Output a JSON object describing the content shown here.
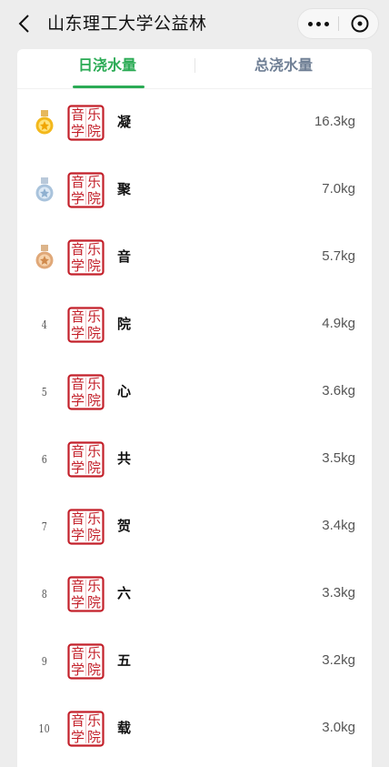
{
  "nav": {
    "title": "山东理工大学公益林"
  },
  "tabs": [
    {
      "label": "日浇水量",
      "active": true
    },
    {
      "label": "总浇水量",
      "active": false
    }
  ],
  "colors": {
    "accent": "#2bab55",
    "inactive_tab": "#6f7f95",
    "seal_red": "#c3202a",
    "gold": "#f0b400",
    "silver": "#a9c3dc",
    "bronze": "#d9a06a"
  },
  "avatar": {
    "chars": [
      "音",
      "乐",
      "学",
      "院"
    ]
  },
  "rankings": [
    {
      "rank": "1",
      "medal": "gold-medal-icon",
      "name": "凝",
      "amount": "16.3kg"
    },
    {
      "rank": "2",
      "medal": "silver-medal-icon",
      "name": "聚",
      "amount": "7.0kg"
    },
    {
      "rank": "3",
      "medal": "bronze-medal-icon",
      "name": "音",
      "amount": "5.7kg"
    },
    {
      "rank": "4",
      "medal": "",
      "name": "院",
      "amount": "4.9kg"
    },
    {
      "rank": "5",
      "medal": "",
      "name": "心",
      "amount": "3.6kg"
    },
    {
      "rank": "6",
      "medal": "",
      "name": "共",
      "amount": "3.5kg"
    },
    {
      "rank": "7",
      "medal": "",
      "name": "贺",
      "amount": "3.4kg"
    },
    {
      "rank": "8",
      "medal": "",
      "name": "六",
      "amount": "3.3kg"
    },
    {
      "rank": "9",
      "medal": "",
      "name": "五",
      "amount": "3.2kg"
    },
    {
      "rank": "10",
      "medal": "",
      "name": "载",
      "amount": "3.0kg"
    }
  ]
}
